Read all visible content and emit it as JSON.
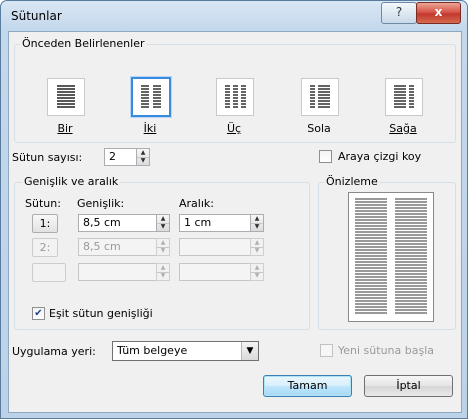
{
  "window": {
    "title": "Sütunlar",
    "help_glyph": "?",
    "close_glyph": "x"
  },
  "presets": {
    "group_label": "Önceden Belirlenenler",
    "items": [
      {
        "label": "Bir",
        "icon": "one-column-icon",
        "selected": false
      },
      {
        "label": "İki",
        "icon": "two-columns-icon",
        "selected": true
      },
      {
        "label": "Üç",
        "icon": "three-columns-icon",
        "selected": false
      },
      {
        "label": "Sola",
        "icon": "left-columns-icon",
        "selected": false
      },
      {
        "label": "Sağa",
        "icon": "right-columns-icon",
        "selected": false
      }
    ]
  },
  "column_count": {
    "label": "Sütun sayısı:",
    "value": "2"
  },
  "line_between": {
    "label": "Araya çizgi koy",
    "checked": false
  },
  "width_spacing": {
    "group_label": "Genişlik ve aralık",
    "col_header": "Sütun:",
    "width_header": "Genişlik:",
    "spacing_header": "Aralık:",
    "rows": [
      {
        "num": "1:",
        "width": "8,5 cm",
        "spacing": "1 cm",
        "enabled": true
      },
      {
        "num": "2:",
        "width": "8,5 cm",
        "spacing": "",
        "enabled": false
      },
      {
        "num": "",
        "width": "",
        "spacing": "",
        "enabled": false
      }
    ]
  },
  "equal_width": {
    "label": "Eşit sütun genişliği",
    "checked": true
  },
  "preview": {
    "group_label": "Önizleme"
  },
  "apply_to": {
    "label": "Uygulama yeri:",
    "value": "Tüm belgeye"
  },
  "new_column": {
    "label": "Yeni sütuna başla",
    "checked": false
  },
  "buttons": {
    "ok": "Tamam",
    "cancel": "İptal"
  },
  "colors": {
    "selection_border": "#3a8be0",
    "close_red": "#c2382c",
    "default_button": "#3c7fb1"
  }
}
